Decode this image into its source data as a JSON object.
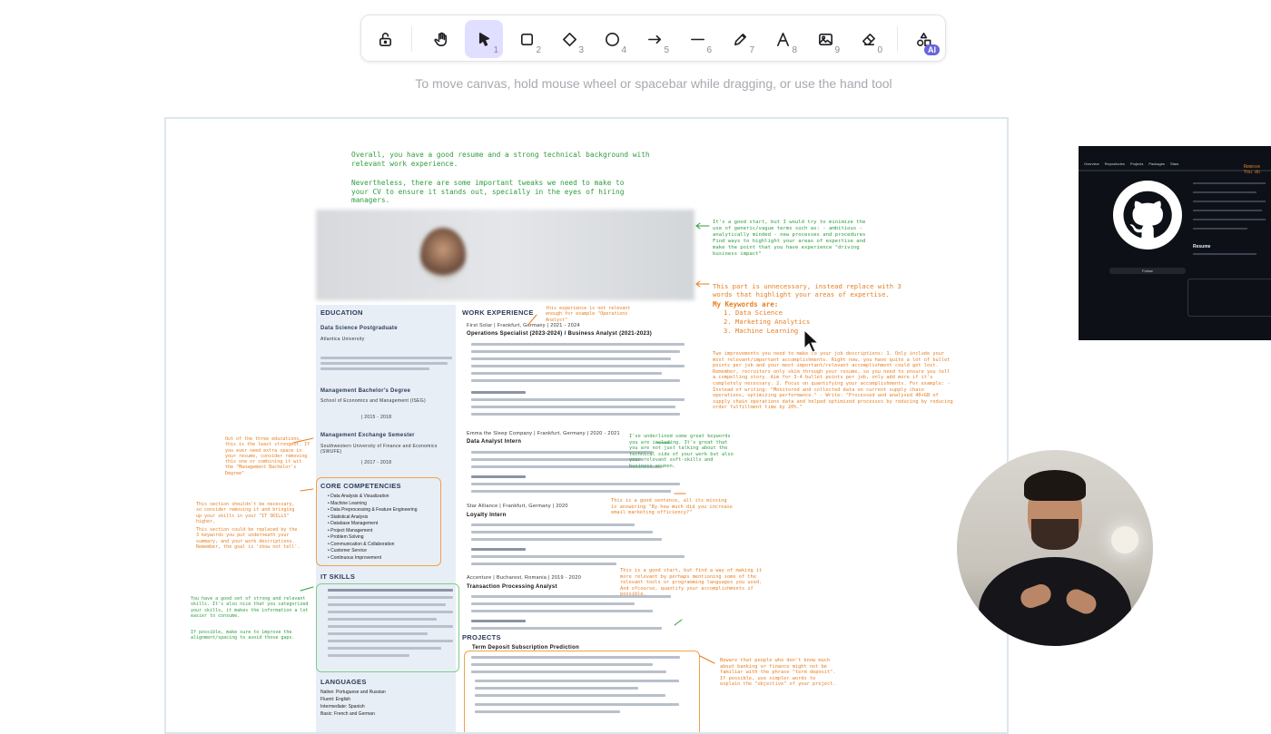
{
  "toolbar": {
    "tools": [
      {
        "name": "lock",
        "number": ""
      },
      {
        "name": "hand",
        "number": ""
      },
      {
        "name": "selection",
        "number": "1"
      },
      {
        "name": "rectangle",
        "number": "2"
      },
      {
        "name": "diamond",
        "number": "3"
      },
      {
        "name": "ellipse",
        "number": "4"
      },
      {
        "name": "arrow",
        "number": "5"
      },
      {
        "name": "line",
        "number": "6"
      },
      {
        "name": "draw",
        "number": "7"
      },
      {
        "name": "text",
        "number": "8"
      },
      {
        "name": "image",
        "number": "9"
      },
      {
        "name": "eraser",
        "number": "0"
      },
      {
        "name": "shapes-ai",
        "number": ""
      }
    ],
    "ai_badge": "AI"
  },
  "hint": "To move canvas, hold mouse wheel or spacebar while dragging, or use the hand tool",
  "resume": {
    "intro_1": "Overall, you have a good resume and a strong technical background with relevant work experience.",
    "intro_2": "Nevertheless, there are some important tweaks we need to make to your CV to ensure it stands out, specially in the eyes of hiring managers.",
    "sections_left": [
      "EDUCATION",
      "CORE COMPETENCIES",
      "IT SKILLS",
      "LANGUAGES"
    ],
    "sections_right": [
      "WORK EXPERIENCE",
      "PROJECTS"
    ],
    "edu": [
      "Data Science Postgraduate",
      "Atlantica University",
      "Management Bachelor's Degree",
      "School of Economics and Management (ISEG)",
      "| 2015 - 2018",
      "Management Exchange Semester",
      "Southwestern University of Finance and Economics (SWUFE)",
      "| 2017 - 2018"
    ],
    "core": [
      "Data Analysis & Visualization",
      "Machine Learning",
      "Data Preprocessing & Feature Engineering",
      "Statistical Analysis",
      "Database Management",
      "Project Management",
      "Problem Solving",
      "Communication & Collaboration",
      "Customer Service",
      "Continuous Improvement"
    ],
    "languages": [
      "Native: Portuguese and Russian",
      "Fluent: English",
      "Intermediate: Spanish",
      "Basic: French and German"
    ],
    "jobs": [
      {
        "company": "First Solar | Frankfurt, Germany | 2021 - 2024",
        "title": "Operations Specialist (2023-2024) / Business Analyst (2021-2023)"
      },
      {
        "company": "Emma the Sleep Company | Frankfurt, Germany | 2020 - 2021",
        "title": "Data Analyst Intern"
      },
      {
        "company": "Star Alliance | Frankfurt, Germany | 2020",
        "title": "Loyalty Intern"
      },
      {
        "company": "Accenture | Bucharest, Romania | 2019 - 2020",
        "title": "Transaction Processing Analyst"
      }
    ],
    "project_title": "Term Deposit Subscription Prediction"
  },
  "notes": {
    "about_me": "It's a good start, but I would try to minimize the use of generic/vague terms such as: - ambitious - analytically minded - new processes and procedures Find ways to highlight your areas of expertise and make the point that you have experience \"driving business impact\"",
    "keywords_head": "This part is unnecessary, instead replace with 3 words that highlight your areas of expertise.",
    "keywords_label": "My Keywords are:",
    "keywords": [
      "1. Data Science",
      "2. Marketing Analytics",
      "3. Machine Learning"
    ],
    "improvements": "Two improvements you need to make to your job descriptions: 1. Only include your most relevant/important accomplishments. Right now, you have quite a lot of bullet points per job and your most important/relevant accomplishment could get lost. Remember, recruiters only skim through your resume, so you need to ensure you tell a compelling story. Aim for 3-4 bullet points per job, only add more if it's completely necessary. 2. Focus on quantifying your accomplishments. For example: - Instead of writing: \"Monitored and collected data on current supply chain operations, optimizing performance.\" - Write: \"Processed and analysed 40+GB of supply chain operations data and helped optimized processes by reducing by reducing order fulfillment time by 20%.\"",
    "operations": "this experience is not relevant enough for example \"Operations Analyst\"",
    "underlined": "I've underlined some great keywords you are including. It's great that you are not just talking about the technical side of your work but also your relevant soft-skills and business acumen.",
    "good_sentence": "This is a good sentence, all its missing is answering \"By how much did you increase email marketing efficiency?\"",
    "good_start_2": "This is a good start, but find a way of making it more relevant by perhaps mentioning some of the relevant tools or programming languages you used. And ofcourse, quantify your accomplishments if possible.",
    "education_note": "Out of the three educations, this is the least strongest. If you ever need extra space in your resume, consider removing this one or combining it wit the \"Management Bachelor's Degree\"",
    "core_note_1": "This section shouldn't be necessary, so consider removing it and bringing up your skills in your \"IT SKILLS\" higher.",
    "core_note_2": "This section could be replaced by the 3 keywords you put underneath your summary, and your work descriptions. Remember, the goal is 'show not tell'.",
    "skills_note_1": "You have a good set of strong and relevant skills. It's also nice that you categorized your skills, it makes the information a lot easier to consume.",
    "skills_note_2": "If possible, make sure to improve the alignment/spacing to avoid those gaps.",
    "term_note": "Beware that people who don't know much about banking or finance might not be familiar with the phrase \"term deposit\". If possible, use simpler words to explain the \"objective\" of your project."
  },
  "github": {
    "tabs": [
      "Overview",
      "Repositories",
      "Projects",
      "Packages",
      "Stars"
    ],
    "follow": "Follow",
    "resume": "Resume",
    "note": "Remove You do"
  }
}
